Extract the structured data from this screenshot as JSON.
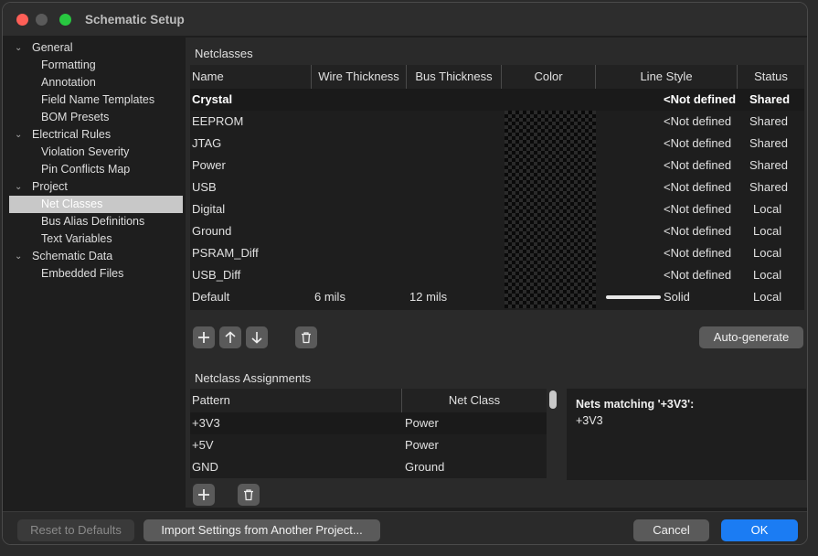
{
  "window": {
    "title": "Schematic Setup"
  },
  "sidebar": {
    "items": [
      {
        "label": "General",
        "level": 0,
        "expanded": true
      },
      {
        "label": "Formatting",
        "level": 1
      },
      {
        "label": "Annotation",
        "level": 1
      },
      {
        "label": "Field Name Templates",
        "level": 1
      },
      {
        "label": "BOM Presets",
        "level": 1
      },
      {
        "label": "Electrical Rules",
        "level": 0,
        "expanded": true
      },
      {
        "label": "Violation Severity",
        "level": 1
      },
      {
        "label": "Pin Conflicts Map",
        "level": 1
      },
      {
        "label": "Project",
        "level": 0,
        "expanded": true
      },
      {
        "label": "Net Classes",
        "level": 1,
        "selected": true
      },
      {
        "label": "Bus Alias Definitions",
        "level": 1
      },
      {
        "label": "Text Variables",
        "level": 1
      },
      {
        "label": "Schematic Data",
        "level": 0,
        "expanded": true
      },
      {
        "label": "Embedded Files",
        "level": 1
      }
    ]
  },
  "netclasses": {
    "title": "Netclasses",
    "columns": [
      "Name",
      "Wire Thickness",
      "Bus Thickness",
      "Color",
      "Line Style",
      "Status"
    ],
    "rows": [
      {
        "name": "Crystal",
        "wire": "",
        "bus": "",
        "line_style": "<Not defined",
        "status": "Shared"
      },
      {
        "name": "EEPROM",
        "wire": "",
        "bus": "",
        "line_style": "<Not defined",
        "status": "Shared"
      },
      {
        "name": "JTAG",
        "wire": "",
        "bus": "",
        "line_style": "<Not defined",
        "status": "Shared"
      },
      {
        "name": "Power",
        "wire": "",
        "bus": "",
        "line_style": "<Not defined",
        "status": "Shared"
      },
      {
        "name": "USB",
        "wire": "",
        "bus": "",
        "line_style": "<Not defined",
        "status": "Shared"
      },
      {
        "name": "Digital",
        "wire": "",
        "bus": "",
        "line_style": "<Not defined",
        "status": "Local"
      },
      {
        "name": "Ground",
        "wire": "",
        "bus": "",
        "line_style": "<Not defined",
        "status": "Local"
      },
      {
        "name": "PSRAM_Diff",
        "wire": "",
        "bus": "",
        "line_style": "<Not defined",
        "status": "Local"
      },
      {
        "name": "USB_Diff",
        "wire": "",
        "bus": "",
        "line_style": "<Not defined",
        "status": "Local"
      },
      {
        "name": "Default",
        "wire": "6 mils",
        "bus": "12 mils",
        "line_style": "Solid",
        "status": "Local"
      }
    ],
    "auto_generate_label": "Auto-generate"
  },
  "assignments": {
    "title": "Netclass Assignments",
    "columns": [
      "Pattern",
      "Net Class"
    ],
    "rows": [
      {
        "pattern": "+3V3",
        "net_class": "Power"
      },
      {
        "pattern": "+5V",
        "net_class": "Power"
      },
      {
        "pattern": "GND",
        "net_class": "Ground"
      }
    ],
    "matching_title": "Nets matching '+3V3':",
    "matching_items": [
      "+3V3"
    ]
  },
  "footer": {
    "reset_label": "Reset to Defaults",
    "import_label": "Import Settings from Another Project...",
    "cancel_label": "Cancel",
    "ok_label": "OK"
  },
  "icons": {
    "add": "plus-icon",
    "move_up": "arrow-up-icon",
    "move_down": "arrow-down-icon",
    "delete": "trash-icon",
    "expand": "chevron-down-icon"
  },
  "colors": {
    "accent": "#1b7cf3",
    "close": "#fe5f57",
    "maximize": "#28c840"
  }
}
